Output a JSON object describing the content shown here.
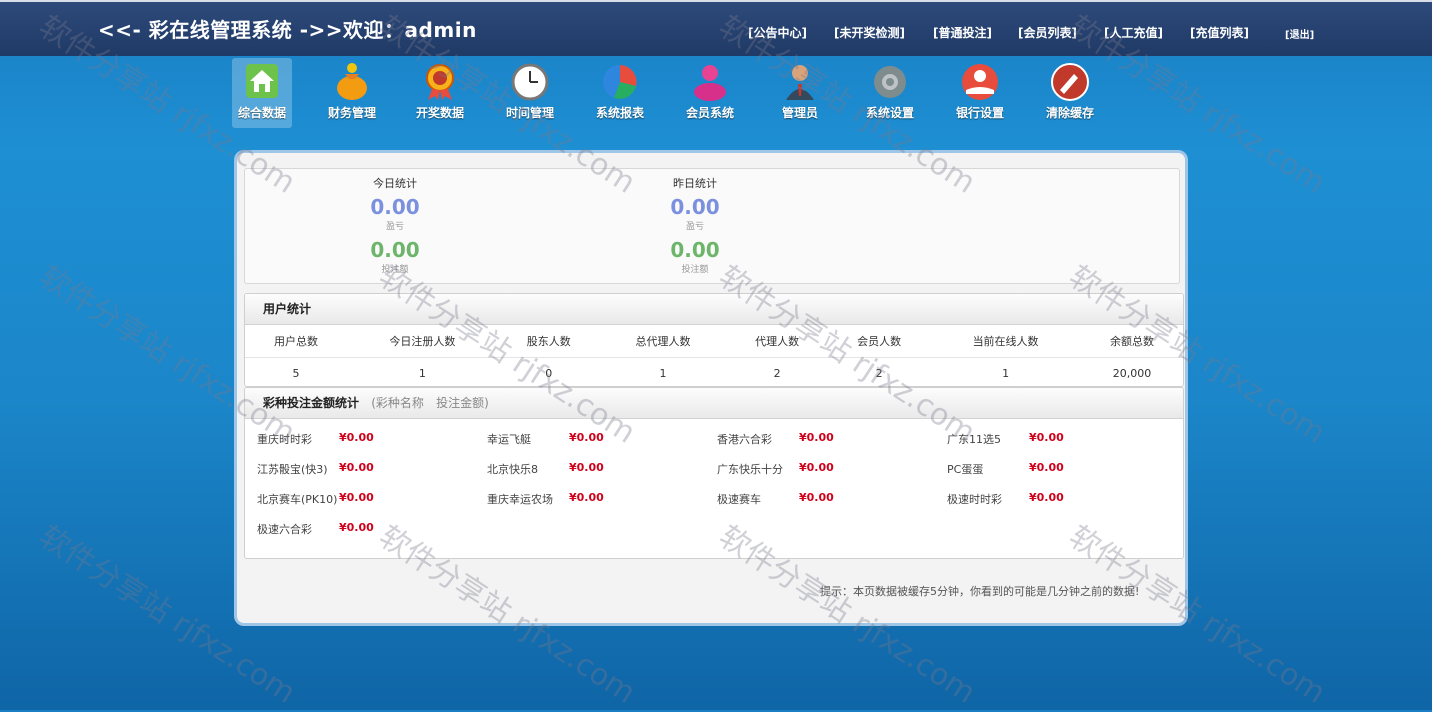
{
  "header": {
    "title": "<<- 彩在线管理系统 ->>欢迎：admin",
    "links": [
      "[公告中心]",
      "[未开奖检测]",
      "[普通投注]",
      "[会员列表]",
      "[人工充值]",
      "[充值列表]",
      "[退出]"
    ]
  },
  "nav": {
    "items": [
      {
        "label": "综合数据",
        "icon": "home-icon"
      },
      {
        "label": "财务管理",
        "icon": "money-bag-icon"
      },
      {
        "label": "开奖数据",
        "icon": "award-medal-icon"
      },
      {
        "label": "时间管理",
        "icon": "clock-icon"
      },
      {
        "label": "系统报表",
        "icon": "pie-chart-icon"
      },
      {
        "label": "会员系统",
        "icon": "users-icon"
      },
      {
        "label": "管理员",
        "icon": "admin-person-icon"
      },
      {
        "label": "系统设置",
        "icon": "gear-icon"
      },
      {
        "label": "银行设置",
        "icon": "bank-hand-icon"
      },
      {
        "label": "清除缓存",
        "icon": "broom-icon"
      }
    ]
  },
  "today": {
    "title": "今日统计",
    "profit": "0.00",
    "profit_label": "盈亏",
    "bet": "0.00",
    "bet_label": "投注额"
  },
  "yesterday": {
    "title": "昨日统计",
    "profit": "0.00",
    "profit_label": "盈亏",
    "bet": "0.00",
    "bet_label": "投注额"
  },
  "users": {
    "title": "用户统计",
    "headers": [
      "用户总数",
      "今日注册人数",
      "股东人数",
      "总代理人数",
      "代理人数",
      "会员人数",
      "当前在线人数",
      "余额总数"
    ],
    "values": [
      "5",
      "1",
      "0",
      "1",
      "2",
      "2",
      "1",
      "20,000"
    ]
  },
  "lottery": {
    "title": "彩种投注金额统计",
    "tabs": [
      "(彩种名称",
      "投注金额)"
    ],
    "items": [
      {
        "name": "重庆时时彩",
        "amount": "¥0.00"
      },
      {
        "name": "幸运飞艇",
        "amount": "¥0.00"
      },
      {
        "name": "香港六合彩",
        "amount": "¥0.00"
      },
      {
        "name": "广东11选5",
        "amount": "¥0.00"
      },
      {
        "name": "江苏骰宝(快3)",
        "amount": "¥0.00"
      },
      {
        "name": "北京快乐8",
        "amount": "¥0.00"
      },
      {
        "name": "广东快乐十分",
        "amount": "¥0.00"
      },
      {
        "name": "PC蛋蛋",
        "amount": "¥0.00"
      },
      {
        "name": "北京赛车(PK10)",
        "amount": "¥0.00"
      },
      {
        "name": "重庆幸运农场",
        "amount": "¥0.00"
      },
      {
        "name": "极速赛车",
        "amount": "¥0.00"
      },
      {
        "name": "极速时时彩",
        "amount": "¥0.00"
      },
      {
        "name": "极速六合彩",
        "amount": "¥0.00"
      }
    ]
  },
  "footnote": "提示：本页数据被缓存5分钟，你看到的可能是几分钟之前的数据!",
  "watermark": "软件分享站 rjfxz.com"
}
